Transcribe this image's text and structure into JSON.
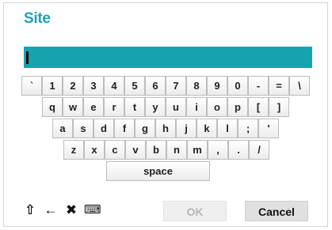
{
  "dialog": {
    "title": "Site"
  },
  "input": {
    "value": ""
  },
  "keyboard": {
    "row1": [
      "`",
      "1",
      "2",
      "3",
      "4",
      "5",
      "6",
      "7",
      "8",
      "9",
      "0",
      "-",
      "=",
      "\\"
    ],
    "row2": [
      "q",
      "w",
      "e",
      "r",
      "t",
      "y",
      "u",
      "i",
      "o",
      "p",
      "[",
      "]"
    ],
    "row3": [
      "a",
      "s",
      "d",
      "f",
      "g",
      "h",
      "j",
      "k",
      "l",
      ";",
      "'"
    ],
    "row4": [
      "z",
      "x",
      "c",
      "v",
      "b",
      "n",
      "m",
      ",",
      ".",
      "/"
    ],
    "space_label": "space"
  },
  "toolbar": {
    "shift_icon": "⇧",
    "backspace_icon": "←",
    "clear_icon": "✖",
    "keyboard_icon": "⌨"
  },
  "buttons": {
    "ok_label": "OK",
    "cancel_label": "Cancel"
  }
}
